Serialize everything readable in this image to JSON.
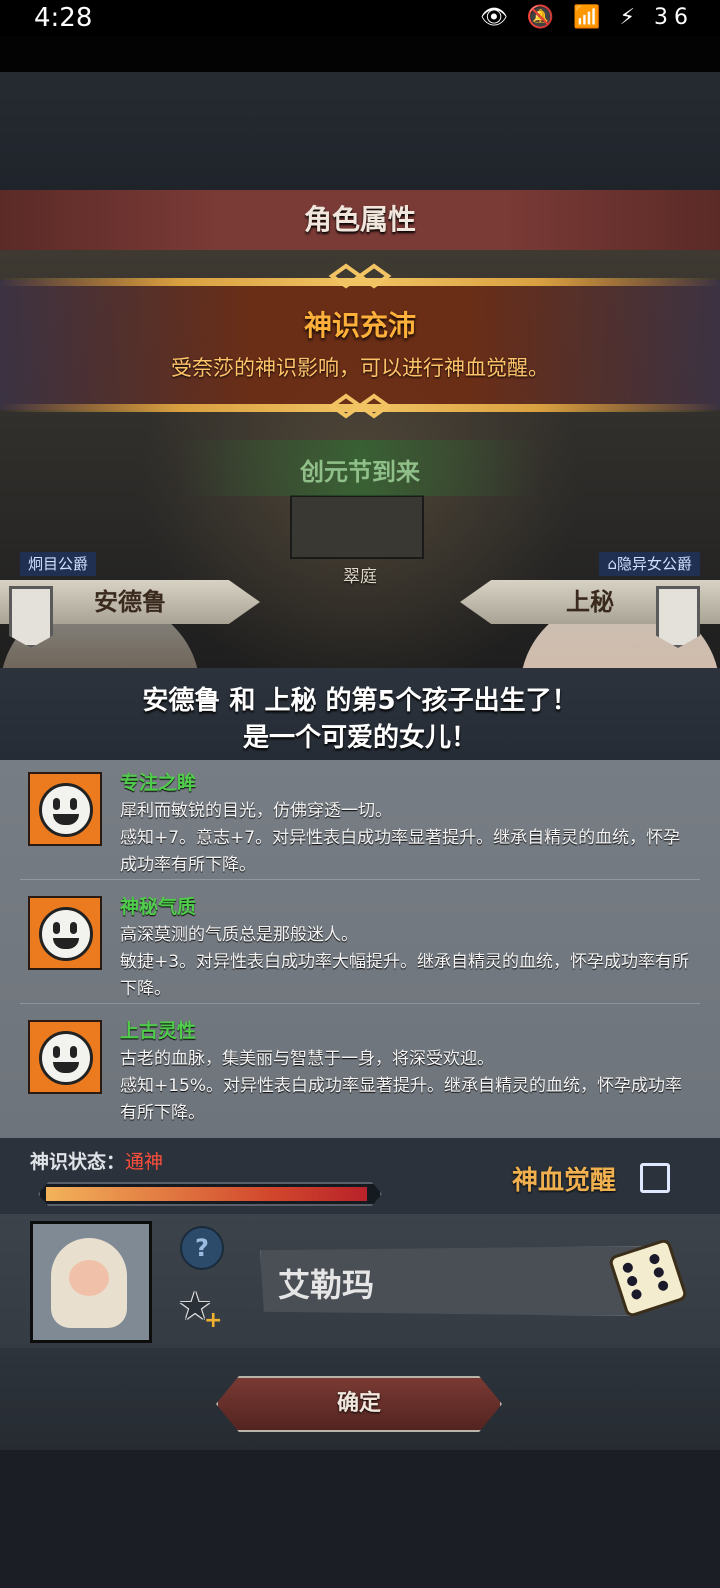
{
  "status_bar": {
    "time": "4:28",
    "battery": "36",
    "icons": "👁 🔕 📶 ⚡"
  },
  "panel": {
    "title": "角色属性"
  },
  "event": {
    "title": "神识充沛",
    "description": "受奈莎的神识影响，可以进行神血觉醒。",
    "festival": "创元节到来"
  },
  "location": {
    "name": "翠庭"
  },
  "parents": {
    "father": {
      "title": "炯目公爵",
      "name": "安德鲁"
    },
    "mother": {
      "title": "隐异女公爵",
      "name": "上秘"
    }
  },
  "birth": {
    "line1": "安德鲁 和 上秘 的第5个孩子出生了！",
    "line2": "是一个可爱的女儿！"
  },
  "traits": [
    {
      "name": "专注之眸",
      "flavor": "犀利而敏锐的目光，仿佛穿透一切。",
      "effect": "感知+7。意志+7。对异性表白成功率显著提升。继承自精灵的血统，怀孕成功率有所下降。"
    },
    {
      "name": "神秘气质",
      "flavor": "高深莫测的气质总是那般迷人。",
      "effect": "敏捷+3。对异性表白成功率大幅提升。继承自精灵的血统，怀孕成功率有所下降。"
    },
    {
      "name": "上古灵性",
      "flavor": "古老的血脉，集美丽与智慧于一身，将深受欢迎。",
      "effect": "感知+15%。对异性表白成功率显著提升。继承自精灵的血统，怀孕成功率有所下降。"
    }
  ],
  "divine_state": {
    "label": "神识状态：",
    "value": "通神",
    "progress": 0.98,
    "awaken_label": "神血觉醒",
    "awaken_checked": false
  },
  "child": {
    "name": "艾勒玛",
    "help_icon": "?",
    "star_icon": "★",
    "star_plus": "+"
  },
  "actions": {
    "confirm": "确定"
  },
  "colors": {
    "trait_name": "#4fcc4a",
    "divine_value": "#ff4e3b",
    "event_title": "#ffb03a",
    "awaken": "#f0b050",
    "panel_title_bg": "#7a3a36"
  }
}
